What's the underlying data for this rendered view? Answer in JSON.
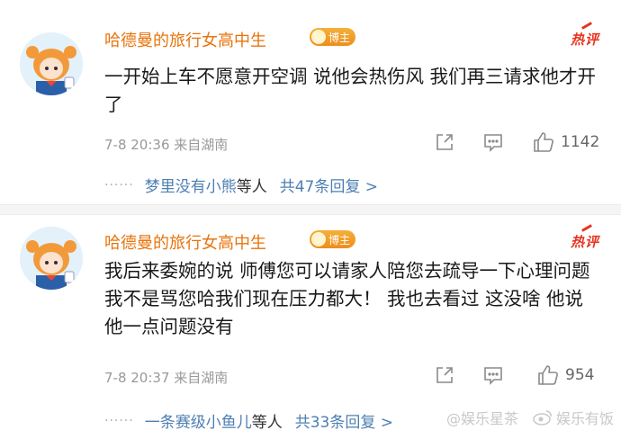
{
  "comments": [
    {
      "username": "哈德曼的旅行女高中生",
      "badge": "博主",
      "hot_label": "热评",
      "text": "一开始上车不愿意开空调 说他会热伤风 我们再三请求他才开了",
      "meta": "7-8 20:36 来自湖南",
      "likes": "1142",
      "reply_names": "梦里没有小熊",
      "reply_suffix": "等人",
      "reply_total": "共47条回复 >"
    },
    {
      "username": "哈德曼的旅行女高中生",
      "badge": "博主",
      "hot_label": "热评",
      "text": "我后来委婉的说 师傅您可以请家人陪您去疏导一下心理问题 我不是骂您哈我们现在压力都大！ 我也去看过 这没啥 他说他一点问题没有",
      "meta": "7-8 20:37 来自湖南",
      "likes": "954",
      "reply_names": "一条赛级小鱼儿",
      "reply_suffix": "等人",
      "reply_total": "共33条回复 >"
    }
  ],
  "watermark": {
    "left": "@娱乐星茶",
    "right": "娱乐有饭"
  },
  "colors": {
    "username": "#e8740c",
    "link": "#4d7fb2",
    "hot": "#e8331f"
  },
  "icons": [
    "avatar",
    "crown-icon",
    "share-icon",
    "comment-icon",
    "like-icon",
    "weibo-logo-icon"
  ]
}
